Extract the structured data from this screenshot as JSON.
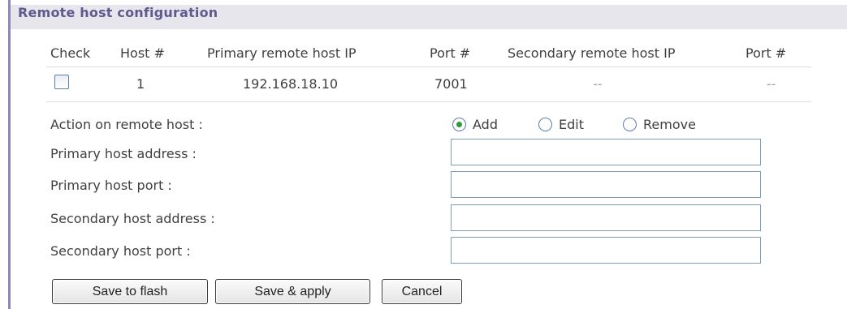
{
  "section": {
    "title": "Remote host configuration"
  },
  "table": {
    "headers": {
      "check": "Check",
      "host": "Host #",
      "primary_ip": "Primary remote host IP",
      "primary_port": "Port #",
      "secondary_ip": "Secondary remote host IP",
      "secondary_port": "Port #"
    },
    "rows": [
      {
        "checked": false,
        "host": "1",
        "primary_ip": "192.168.18.10",
        "primary_port": "7001",
        "secondary_ip": "--",
        "secondary_port": "--"
      }
    ]
  },
  "form": {
    "action_label": "Action on remote host :",
    "actions": [
      "Add",
      "Edit",
      "Remove"
    ],
    "selected_action": "Add",
    "primary_address_label": "Primary host address :",
    "primary_address_value": "",
    "primary_port_label": "Primary host port :",
    "primary_port_value": "",
    "secondary_address_label": "Secondary host address :",
    "secondary_address_value": "",
    "secondary_port_label": "Secondary host port :",
    "secondary_port_value": ""
  },
  "buttons": {
    "save_flash": "Save to flash",
    "save_apply": "Save & apply",
    "cancel": "Cancel"
  },
  "colors": {
    "header_background": "#e6e6ec",
    "title_text": "#5e5a8e",
    "left_rule": "#8f86b6",
    "radio_selected": "#2f9a3c",
    "input_border": "#7f9db9"
  }
}
